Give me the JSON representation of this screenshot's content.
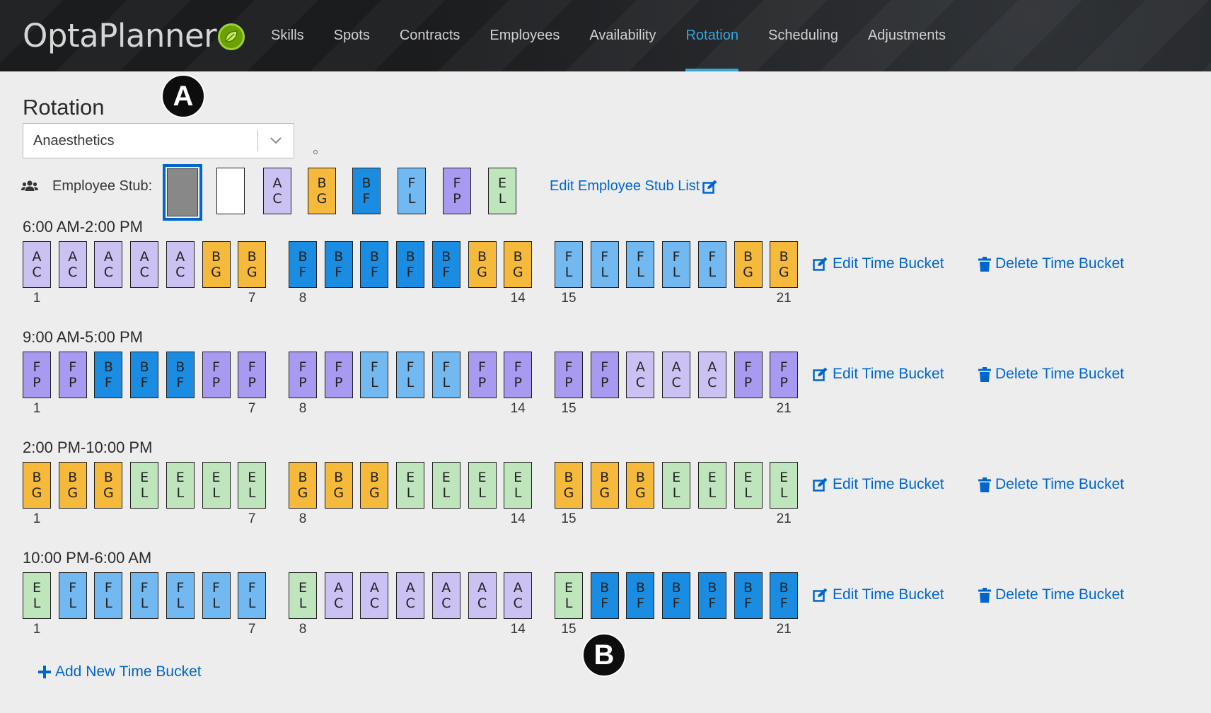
{
  "app": {
    "logo_text": "OptaPlanner"
  },
  "nav": {
    "items": [
      {
        "label": "Skills",
        "active": false
      },
      {
        "label": "Spots",
        "active": false
      },
      {
        "label": "Contracts",
        "active": false
      },
      {
        "label": "Employees",
        "active": false
      },
      {
        "label": "Availability",
        "active": false
      },
      {
        "label": "Rotation",
        "active": true
      },
      {
        "label": "Scheduling",
        "active": false
      },
      {
        "label": "Adjustments",
        "active": false
      }
    ]
  },
  "page": {
    "title": "Rotation",
    "spot_select": {
      "value": "Anaesthetics"
    },
    "markers": {
      "a": "A",
      "b": "B"
    }
  },
  "employee_stub": {
    "label": "Employee Stub:",
    "edit_label": "Edit Employee Stub List",
    "stubs": [
      "selected-empty",
      "empty",
      "AC",
      "BG",
      "BF",
      "FL",
      "FP",
      "EL"
    ]
  },
  "colors": {
    "AC": "#cbc1f3",
    "BG": "#f5b93c",
    "BF": "#1a8de3",
    "FL": "#72b9f2",
    "FP": "#a99af1",
    "EL": "#bfe5bc",
    "empty": "#ffffff",
    "link": "#0066cc",
    "nav_active": "#39a5dc"
  },
  "buckets": [
    {
      "title": "6:00 AM-2:00 PM",
      "weeks": [
        [
          "AC",
          "AC",
          "AC",
          "AC",
          "AC",
          "BG",
          "BG"
        ],
        [
          "BF",
          "BF",
          "BF",
          "BF",
          "BF",
          "BG",
          "BG"
        ],
        [
          "FL",
          "FL",
          "FL",
          "FL",
          "FL",
          "BG",
          "BG"
        ]
      ],
      "day_labels": [
        "1",
        "7",
        "8",
        "14",
        "15",
        "21"
      ],
      "edit_label": "Edit Time Bucket",
      "delete_label": "Delete Time Bucket"
    },
    {
      "title": "9:00 AM-5:00 PM",
      "weeks": [
        [
          "FP",
          "FP",
          "BF",
          "BF",
          "BF",
          "FP",
          "FP"
        ],
        [
          "FP",
          "FP",
          "FL",
          "FL",
          "FL",
          "FP",
          "FP"
        ],
        [
          "FP",
          "FP",
          "AC",
          "AC",
          "AC",
          "FP",
          "FP"
        ]
      ],
      "day_labels": [
        "1",
        "7",
        "8",
        "14",
        "15",
        "21"
      ],
      "edit_label": "Edit Time Bucket",
      "delete_label": "Delete Time Bucket"
    },
    {
      "title": "2:00 PM-10:00 PM",
      "weeks": [
        [
          "BG",
          "BG",
          "BG",
          "EL",
          "EL",
          "EL",
          "EL"
        ],
        [
          "BG",
          "BG",
          "BG",
          "EL",
          "EL",
          "EL",
          "EL"
        ],
        [
          "BG",
          "BG",
          "BG",
          "EL",
          "EL",
          "EL",
          "EL"
        ]
      ],
      "day_labels": [
        "1",
        "7",
        "8",
        "14",
        "15",
        "21"
      ],
      "edit_label": "Edit Time Bucket",
      "delete_label": "Delete Time Bucket"
    },
    {
      "title": "10:00 PM-6:00 AM",
      "weeks": [
        [
          "EL",
          "FL",
          "FL",
          "FL",
          "FL",
          "FL",
          "FL"
        ],
        [
          "EL",
          "AC",
          "AC",
          "AC",
          "AC",
          "AC",
          "AC"
        ],
        [
          "EL",
          "BF",
          "BF",
          "BF",
          "BF",
          "BF",
          "BF"
        ]
      ],
      "day_labels": [
        "1",
        "7",
        "8",
        "14",
        "15",
        "21"
      ],
      "edit_label": "Edit Time Bucket",
      "delete_label": "Delete Time Bucket"
    }
  ],
  "add_bucket_label": "Add New Time Bucket"
}
